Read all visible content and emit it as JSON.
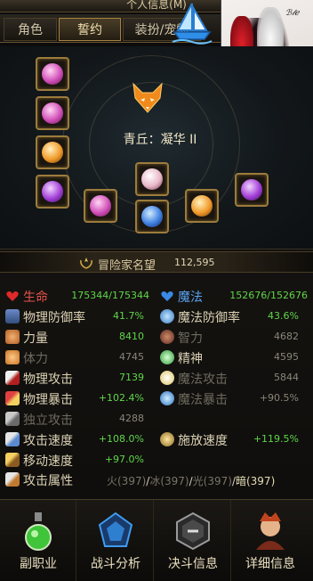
{
  "window": {
    "title": "个人信息(M)"
  },
  "tabs": [
    {
      "label": "角色",
      "active": false
    },
    {
      "label": "誓约",
      "active": true
    },
    {
      "label": "装扮/宠物",
      "active": false
    }
  ],
  "pact": {
    "name": "青丘：凝华 II",
    "icon": "fox-spirit-icon"
  },
  "portrait": {
    "signature": "dnfsig"
  },
  "fame": {
    "label": "冒险家名望",
    "value": "112,595",
    "icon": "laurel-icon"
  },
  "stats": {
    "hp": {
      "label": "生命",
      "value": "175344/175344",
      "icon": "heart-icon",
      "color": "#e02a2a"
    },
    "mp": {
      "label": "魔法",
      "value": "152676/152676",
      "icon": "mana-heart-icon",
      "color": "#3a8ae6"
    },
    "phys_def": {
      "label": "物理防御率",
      "value": "41.7%"
    },
    "mag_def": {
      "label": "魔法防御率",
      "value": "43.6%"
    },
    "str": {
      "label": "力量",
      "value": "8410"
    },
    "int": {
      "label": "智力",
      "value": "4682"
    },
    "vit": {
      "label": "体力",
      "value": "4745"
    },
    "spr": {
      "label": "精神",
      "value": "4595"
    },
    "phys_atk": {
      "label": "物理攻击",
      "value": "7139"
    },
    "mag_atk": {
      "label": "魔法攻击",
      "value": "5844"
    },
    "phys_crit": {
      "label": "物理暴击",
      "value": "+102.4%"
    },
    "mag_crit": {
      "label": "魔法暴击",
      "value": "+90.5%"
    },
    "indep_atk": {
      "label": "独立攻击",
      "value": "4288"
    },
    "atk_speed": {
      "label": "攻击速度",
      "value": "+108.0%"
    },
    "cast_speed": {
      "label": "施放速度",
      "value": "+119.5%"
    },
    "move_speed": {
      "label": "移动速度",
      "value": "+97.0%"
    },
    "element": {
      "label": "攻击属性",
      "fire": "火(397)",
      "ice": "冰(397)",
      "light": "光(397)",
      "dark": "暗(397)"
    }
  },
  "bottom_buttons": [
    {
      "label": "副职业",
      "icon": "potion-flask-icon"
    },
    {
      "label": "战斗分析",
      "icon": "battle-analysis-icon"
    },
    {
      "label": "决斗信息",
      "icon": "duel-hexagon-icon"
    },
    {
      "label": "详细信息",
      "icon": "character-portrait-icon"
    }
  ]
}
